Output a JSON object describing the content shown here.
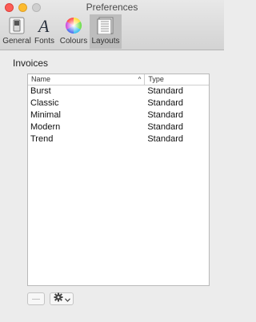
{
  "window": {
    "title": "Preferences"
  },
  "tabs": [
    {
      "label": "General",
      "icon": "general-switch-icon"
    },
    {
      "label": "Fonts",
      "icon": "font-a-icon"
    },
    {
      "label": "Colours",
      "icon": "color-wheel-icon"
    },
    {
      "label": "Layouts",
      "icon": "layouts-grid-icon",
      "active": true
    }
  ],
  "invoices": {
    "label": "Invoices",
    "columns": {
      "name": "Name",
      "type": "Type",
      "sort_indicator": "^"
    },
    "rows": [
      {
        "name": "Burst",
        "type": "Standard"
      },
      {
        "name": "Classic",
        "type": "Standard"
      },
      {
        "name": "Minimal",
        "type": "Standard"
      },
      {
        "name": "Modern",
        "type": "Standard"
      },
      {
        "name": "Trend",
        "type": "Standard"
      }
    ]
  },
  "footer": {
    "remove_label": "—",
    "action_icon": "gear-icon"
  },
  "colors": {
    "active_tab": "#bdbdbd",
    "close": "#fc5d57",
    "minimize": "#fdbb2e"
  }
}
